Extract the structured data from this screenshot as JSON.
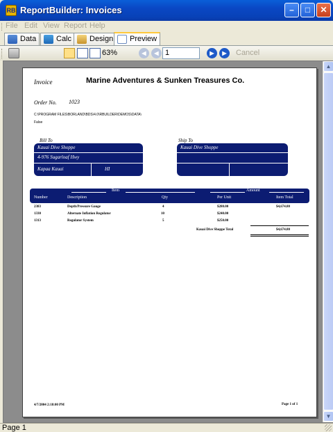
{
  "window": {
    "title": "ReportBuilder: Invoices",
    "app_icon": "RB",
    "minimize": "–",
    "maximize": "□",
    "close": "✕"
  },
  "menu": [
    "File",
    "Edit",
    "View",
    "Report",
    "Help"
  ],
  "tabs": [
    {
      "label": "Data"
    },
    {
      "label": "Calc"
    },
    {
      "label": "Design"
    },
    {
      "label": "Preview"
    }
  ],
  "toolbar": {
    "zoom": "63%",
    "page": "1",
    "cancel": "Cancel"
  },
  "report": {
    "header_label": "Invoice",
    "company": "Marine Adventures & Sunken Treasures Co.",
    "order_label": "Order No.",
    "order_no": "1023",
    "path": "C:\\PROGRAM FILES\\BORLAND\\BDS\\4.0\\RBUILDER\\DEMOS\\DATA\\",
    "flag": "False",
    "bill_to_label": "Bill To",
    "ship_to_label": "Ship To",
    "bill_to": {
      "name": "Kauai Dive Shoppe",
      "address": "4-976 Sugarloaf Hwy",
      "city": "Kapaa Kauai",
      "state": "HI"
    },
    "ship_to": {
      "name": "Kauai Dive Shoppe"
    },
    "group_item": "Item",
    "group_amount": "Amount",
    "columns": {
      "number": "Number",
      "description": "Description",
      "qty": "Qty",
      "per_unit": "Per Unit",
      "item_total": "Item Total"
    },
    "rows": [
      {
        "number": "2383",
        "description": "Depth/Pressure Gauge",
        "qty": "4",
        "per_unit": "$280.00",
        "item_total": "$4,674.80"
      },
      {
        "number": "1330",
        "description": "Alternate Inflation Regulator",
        "qty": "10",
        "per_unit": "$240.00",
        "item_total": ""
      },
      {
        "number": "1313",
        "description": "Regulator System",
        "qty": "5",
        "per_unit": "$250.00",
        "item_total": ""
      }
    ],
    "total_label": "Kauai Dive Shoppe  Total",
    "total": "$4,674.80",
    "footer_date": "4/7/2004 2:18:00 PM",
    "footer_page": "Page 1 of 1"
  },
  "status": {
    "text": "Page 1"
  }
}
